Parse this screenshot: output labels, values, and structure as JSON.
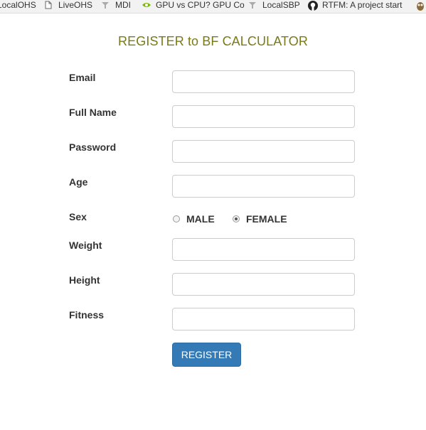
{
  "bookmarks": [
    {
      "label": "LocalOHS",
      "icon": "none"
    },
    {
      "label": "LiveOHS",
      "icon": "page-icon"
    },
    {
      "label": "MDI",
      "icon": "tool-icon"
    },
    {
      "label": "GPU vs CPU? GPU Co",
      "icon": "nvidia-icon"
    },
    {
      "label": "LocalSBP",
      "icon": "tool-icon"
    },
    {
      "label": "RTFM: A project start",
      "icon": "github-icon"
    },
    {
      "label": "",
      "icon": "owl-icon"
    }
  ],
  "form": {
    "title": "REGISTER to BF CALCULATOR",
    "email_label": "Email",
    "email_value": "",
    "fullname_label": "Full Name",
    "fullname_value": "",
    "password_label": "Password",
    "password_value": "",
    "age_label": "Age",
    "age_value": "",
    "sex_label": "Sex",
    "sex_options": [
      "MALE",
      "FEMALE"
    ],
    "sex_selected": "FEMALE",
    "weight_label": "Weight",
    "weight_value": "",
    "height_label": "Height",
    "height_value": "",
    "fitness_label": "Fitness",
    "fitness_value": "",
    "submit_label": "REGISTER"
  },
  "colors": {
    "title": "#7a7a1a",
    "button": "#337ab7",
    "label": "#333333",
    "input_border": "#cccccc"
  }
}
